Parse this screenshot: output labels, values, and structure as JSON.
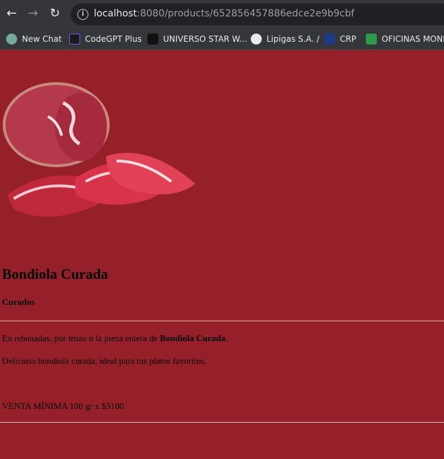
{
  "browser": {
    "url_host": "localhost",
    "url_rest": ":8080/products/652856457886edce2e9b9cbf",
    "bookmarks": [
      {
        "label": "New Chat",
        "icon": "openai-icon"
      },
      {
        "label": "CodeGPT Plus",
        "icon": "codegpt-icon"
      },
      {
        "label": "UNIVERSO STAR W...",
        "icon": "starwars-icon"
      },
      {
        "label": "Lipigas S.A. /",
        "icon": "globe-icon"
      },
      {
        "label": "CRP",
        "icon": "eu-flag-icon"
      },
      {
        "label": "OFICINAS MONDA",
        "icon": "plus-icon"
      }
    ]
  },
  "product": {
    "name": "Bondiola Curada",
    "category": "Curados",
    "desc_prefix": "En rebanadas, por trozo o la pieza entera de ",
    "desc_bold": "Bondiola Curada",
    "desc_suffix": ".",
    "description": "Deliciosa bondiola curada, ideal para tus platos favoritos.",
    "min_sale": "VENTA MÍNIMA 100 gr x $3100."
  },
  "colors": {
    "page_bg": "#96202a",
    "chrome_bg": "#35363a"
  }
}
